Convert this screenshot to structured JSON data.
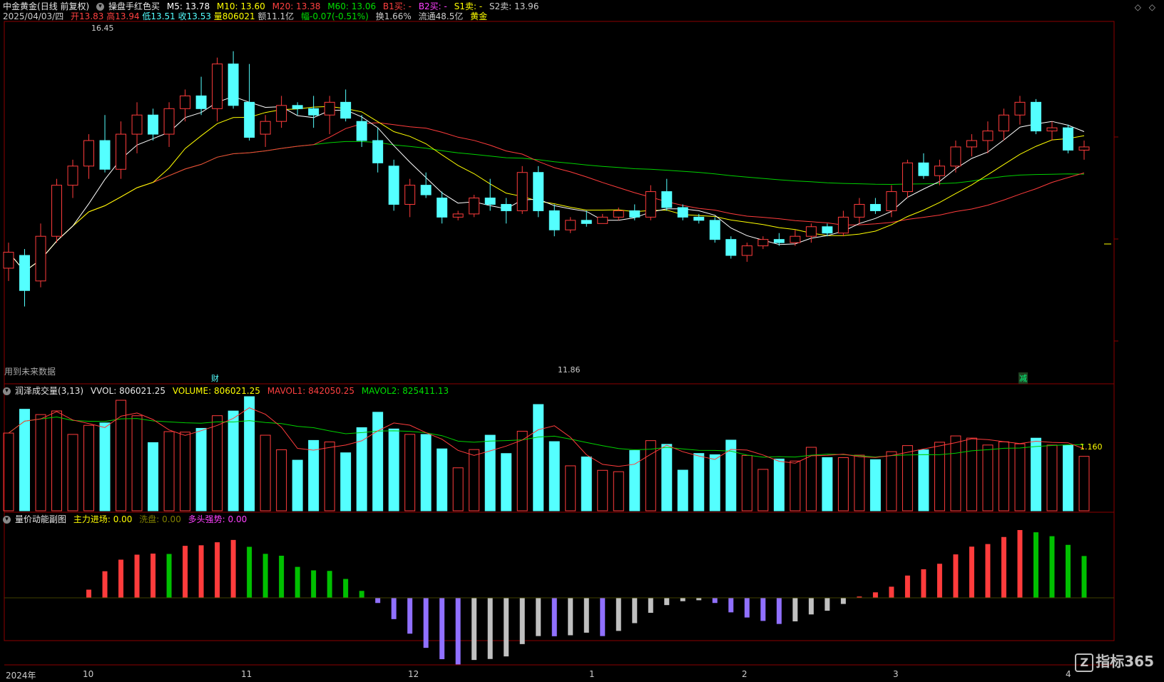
{
  "header": {
    "stock_name": "中金黄金",
    "period": "(日线 前复权)",
    "formula": "操盘手红色买",
    "m5": "M5: 13.78",
    "m10": "M10: 13.60",
    "m20": "M20: 13.38",
    "m60": "M60: 13.06",
    "b1": "B1买: -",
    "b2": "B2买: -",
    "s1": "S1卖: -",
    "s2": "S2卖: 13.96",
    "date": "2025/04/03/四",
    "open": "开13.83",
    "high": "高13.94",
    "low": "低13.51",
    "close": "收13.53",
    "vol": "量806021",
    "amount": "额11.1亿",
    "change": "幅-0.07(-0.51%)",
    "turnover": "换1.66%",
    "float": "流通48.5亿",
    "sector": "黄金"
  },
  "main_panel": {
    "max_label": "16.45",
    "min_label": "11.86",
    "future_note": "用到未来数据",
    "badge_cai": "财",
    "badge_jian": "减"
  },
  "volume_panel": {
    "title": "润泽成交量",
    "params": "(3,13)",
    "vvol": "VVOL: 806021.25",
    "volume": "VOLUME: 806021.25",
    "mavol1": "MAVOL1: 842050.25",
    "mavol2": "MAVOL2: 825411.13",
    "ratio": "1.160"
  },
  "momentum_panel": {
    "title": "量价动能副图",
    "main_in": "主力进场: 0.00",
    "wash": "洗盘: 0.00",
    "bull": "多头强势: 0.00"
  },
  "x_axis": [
    "2024年",
    "10",
    "11",
    "12",
    "1",
    "2",
    "3",
    "4"
  ],
  "brand": {
    "name": "指标365"
  },
  "colors": {
    "up": "#ff3c3c",
    "down": "#54ffff",
    "ma5": "#ffffff",
    "ma10": "#ffff00",
    "ma20": "#ff3c3c",
    "ma60": "#00d000",
    "grid": "#8b0000"
  },
  "chart_data": {
    "type": "candlestick",
    "y_range": [
      11.5,
      17.0
    ],
    "ohlc": [
      [
        13.2,
        13.6,
        13.0,
        13.45
      ],
      [
        13.4,
        13.5,
        12.6,
        12.85
      ],
      [
        13.0,
        13.9,
        12.9,
        13.7
      ],
      [
        13.7,
        14.6,
        13.6,
        14.5
      ],
      [
        14.5,
        14.9,
        14.3,
        14.8
      ],
      [
        14.8,
        15.3,
        14.6,
        15.2
      ],
      [
        15.2,
        15.6,
        14.7,
        14.75
      ],
      [
        14.75,
        15.5,
        14.6,
        15.3
      ],
      [
        15.3,
        15.8,
        15.0,
        15.6
      ],
      [
        15.6,
        15.7,
        15.2,
        15.3
      ],
      [
        15.3,
        15.8,
        15.1,
        15.7
      ],
      [
        15.7,
        16.0,
        15.5,
        15.9
      ],
      [
        15.9,
        16.2,
        15.6,
        15.7
      ],
      [
        15.7,
        16.5,
        15.5,
        16.4
      ],
      [
        16.4,
        16.6,
        15.7,
        15.75
      ],
      [
        15.8,
        16.4,
        15.2,
        15.25
      ],
      [
        15.3,
        15.6,
        15.1,
        15.5
      ],
      [
        15.5,
        15.9,
        15.4,
        15.75
      ],
      [
        15.75,
        15.8,
        15.6,
        15.7
      ],
      [
        15.7,
        15.9,
        15.4,
        15.6
      ],
      [
        15.6,
        15.9,
        15.3,
        15.8
      ],
      [
        15.8,
        16.0,
        15.5,
        15.55
      ],
      [
        15.5,
        15.6,
        15.1,
        15.2
      ],
      [
        15.2,
        15.4,
        14.7,
        14.85
      ],
      [
        14.8,
        14.9,
        14.1,
        14.2
      ],
      [
        14.2,
        14.6,
        14.0,
        14.5
      ],
      [
        14.5,
        14.7,
        14.3,
        14.35
      ],
      [
        14.3,
        14.4,
        13.9,
        14.0
      ],
      [
        14.0,
        14.1,
        13.95,
        14.05
      ],
      [
        14.05,
        14.35,
        14.0,
        14.3
      ],
      [
        14.3,
        14.6,
        14.1,
        14.2
      ],
      [
        14.2,
        14.3,
        13.9,
        14.1
      ],
      [
        14.1,
        14.8,
        14.05,
        14.7
      ],
      [
        14.7,
        14.8,
        14.0,
        14.1
      ],
      [
        14.1,
        14.2,
        13.7,
        13.8
      ],
      [
        13.8,
        14.0,
        13.75,
        13.95
      ],
      [
        13.95,
        14.1,
        13.85,
        13.9
      ],
      [
        13.9,
        14.05,
        13.9,
        14.0
      ],
      [
        14.0,
        14.15,
        13.95,
        14.1
      ],
      [
        14.1,
        14.2,
        13.95,
        14.0
      ],
      [
        14.0,
        14.5,
        13.95,
        14.4
      ],
      [
        14.4,
        14.6,
        14.1,
        14.15
      ],
      [
        14.15,
        14.2,
        13.95,
        14.0
      ],
      [
        14.0,
        14.05,
        13.9,
        13.95
      ],
      [
        13.95,
        14.0,
        13.6,
        13.65
      ],
      [
        13.65,
        13.7,
        13.35,
        13.4
      ],
      [
        13.4,
        13.6,
        13.3,
        13.55
      ],
      [
        13.55,
        13.7,
        13.5,
        13.65
      ],
      [
        13.65,
        13.75,
        13.55,
        13.6
      ],
      [
        13.6,
        13.8,
        13.55,
        13.7
      ],
      [
        13.7,
        13.9,
        13.6,
        13.85
      ],
      [
        13.85,
        13.9,
        13.7,
        13.75
      ],
      [
        13.75,
        14.1,
        13.7,
        14.0
      ],
      [
        14.0,
        14.3,
        13.9,
        14.2
      ],
      [
        14.2,
        14.3,
        14.05,
        14.1
      ],
      [
        14.1,
        14.5,
        14.0,
        14.4
      ],
      [
        14.4,
        14.9,
        14.3,
        14.85
      ],
      [
        14.85,
        15.0,
        14.6,
        14.65
      ],
      [
        14.65,
        14.9,
        14.5,
        14.8
      ],
      [
        14.8,
        15.2,
        14.7,
        15.1
      ],
      [
        15.1,
        15.3,
        14.95,
        15.2
      ],
      [
        15.2,
        15.5,
        15.0,
        15.35
      ],
      [
        15.35,
        15.7,
        15.2,
        15.6
      ],
      [
        15.6,
        15.9,
        15.45,
        15.8
      ],
      [
        15.8,
        15.85,
        15.3,
        15.35
      ],
      [
        15.35,
        15.5,
        15.2,
        15.4
      ],
      [
        15.4,
        15.45,
        15.0,
        15.05
      ],
      [
        15.05,
        15.2,
        14.9,
        15.1
      ]
    ]
  }
}
